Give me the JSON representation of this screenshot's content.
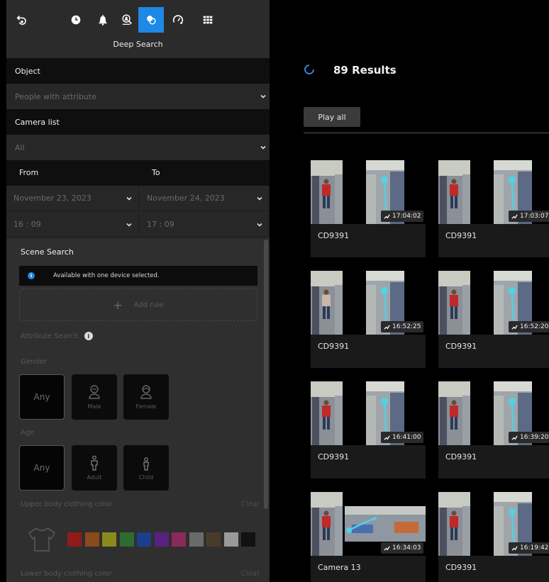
{
  "toolbar": {
    "icons": [
      "back-icon",
      "clock-icon",
      "bell-icon",
      "person-search-icon",
      "deep-search-icon",
      "speedometer-icon",
      "grid-icon"
    ],
    "active": "deep-search-icon",
    "title": "Deep Search"
  },
  "object": {
    "label": "Object",
    "value": "People with attribute"
  },
  "camera_list": {
    "label": "Camera list",
    "value": "All"
  },
  "range": {
    "from_label": "From",
    "to_label": "To",
    "from_date": "November 23, 2023",
    "to_date": "November 24, 2023",
    "from_time": "16 : 09",
    "to_time": "17 : 09"
  },
  "scene": {
    "title": "Scene Search",
    "info": "Available with one device selected.",
    "info_icon": "i",
    "add_rule": "Add rule",
    "add_rule_glyph": "+"
  },
  "attributes": {
    "label": "Attribute Search",
    "info_icon": "i",
    "gender": {
      "label": "Gender",
      "options": [
        "Any",
        "Male",
        "Female"
      ],
      "selected": "Any"
    },
    "age": {
      "label": "Age",
      "options": [
        "Any",
        "Adult",
        "Child"
      ],
      "selected": "Any"
    },
    "upper": {
      "label": "Upper body clothing color",
      "clear": "Clear"
    },
    "lower": {
      "label": "Lower body clothing color",
      "clear": "Clear"
    },
    "colors": [
      "#8f1b1b",
      "#8a4a1b",
      "#8a8a1b",
      "#2e6b2e",
      "#1b3f8a",
      "#5a2080",
      "#8a2a5a",
      "#6a6a6a",
      "#4a3a2a",
      "#9a9a9a",
      "#111111"
    ]
  },
  "results": {
    "count": "89 Results",
    "play_all": "Play all",
    "items": [
      {
        "camera": "CD9391",
        "time": "17:04:02"
      },
      {
        "camera": "CD9391",
        "time": "17:03:07"
      },
      {
        "camera": "CD9391",
        "time": "16:52:25"
      },
      {
        "camera": "CD9391",
        "time": "16:52:20"
      },
      {
        "camera": "CD9391",
        "time": "16:41:00"
      },
      {
        "camera": "CD9391",
        "time": "16:39:20"
      },
      {
        "camera": "Camera 13",
        "time": "16:34:03"
      },
      {
        "camera": "CD9391",
        "time": "16:19:42"
      }
    ]
  }
}
